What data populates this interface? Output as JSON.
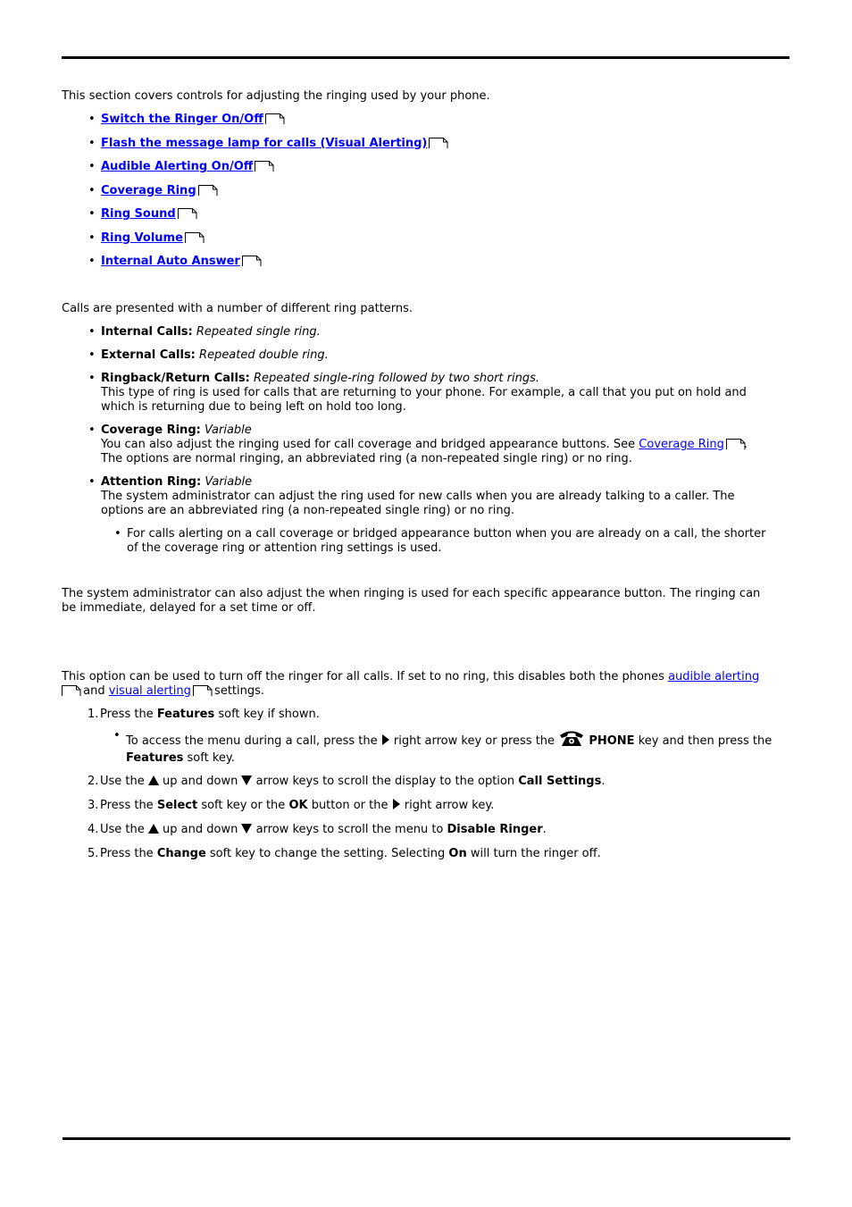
{
  "intro": "This section covers controls for adjusting the ringing used by your phone.",
  "links": [
    "Switch the Ringer On/Off",
    "Flash the message lamp for calls (Visual Alerting)",
    "Audible Alerting On/Off",
    "Coverage Ring",
    "Ring Sound",
    "Ring Volume",
    "Internal Auto Answer"
  ],
  "ring_patterns": {
    "intro": "Calls are presented with a number of different ring patterns.",
    "items": [
      {
        "label": "Internal Calls:",
        "value": "Repeated single ring."
      },
      {
        "label": "External Calls:",
        "value": "Repeated double ring."
      },
      {
        "label": "Ringback/Return Calls:",
        "value": "Repeated single-ring followed by two short rings.",
        "desc": "This type of ring is used for calls that are returning to your phone. For example, a call that you put on hold and which is returning due to being left on hold too long."
      },
      {
        "label": "Coverage Ring:",
        "value": "Variable",
        "desc_before": "You can also adjust the ringing used for call coverage and bridged appearance buttons. See ",
        "desc_link": "Coverage Ring",
        "desc_after": "The options are normal ringing, an abbreviated ring (a non-repeated single ring) or no ring."
      },
      {
        "label": "Attention Ring:",
        "value": "Variable",
        "desc": "The system administrator can adjust the ring used for new calls when you are already talking to a caller. The options are an abbreviated ring (a non-repeated single ring) or no ring.",
        "sub": "For calls alerting on a call coverage or bridged appearance button when you are already on a call, the shorter of the coverage ring or attention ring settings is used."
      }
    ]
  },
  "admin_note": "The system administrator can also adjust the when ringing is used for each specific appearance button. The ringing can be immediate, delayed for a set time or off.",
  "ringer_section": {
    "intro_before": "This option can be used to turn off the ringer for all calls. If set to no ring, this disables both the phones ",
    "link1": "audible alerting",
    "and": "and",
    "link2": "visual alerting",
    "intro_after": "settings.",
    "steps": [
      {
        "num": "1.",
        "parts": [
          "Press the ",
          "Features",
          " soft key if shown."
        ],
        "sub": {
          "t1": "To access the menu during a call, press the ",
          "t2": " right arrow key or press the ",
          "phone": "PHONE",
          "t3": " key and then press the ",
          "features": "Features",
          "t4": " soft key."
        }
      },
      {
        "num": "2.",
        "t1": "Use the ",
        "t2": " up and down ",
        "t3": " arrow keys to scroll the display to the option ",
        "b": "Call Settings",
        "t4": "."
      },
      {
        "num": "3.",
        "t1": "Press the ",
        "b1": "Select",
        "t2": " soft key or the ",
        "b2": "OK",
        "t3": " button or the ",
        "t4": " right arrow key."
      },
      {
        "num": "4.",
        "t1": "Use the ",
        "t2": " up and down ",
        "t3": " arrow keys to scroll the menu to ",
        "b": "Disable Ringer",
        "t4": "."
      },
      {
        "num": "5.",
        "t1": "Press the ",
        "b1": "Change",
        "t2": " soft key to change the setting. Selecting ",
        "b2": "On",
        "t3": " will turn the ringer off."
      }
    ]
  }
}
